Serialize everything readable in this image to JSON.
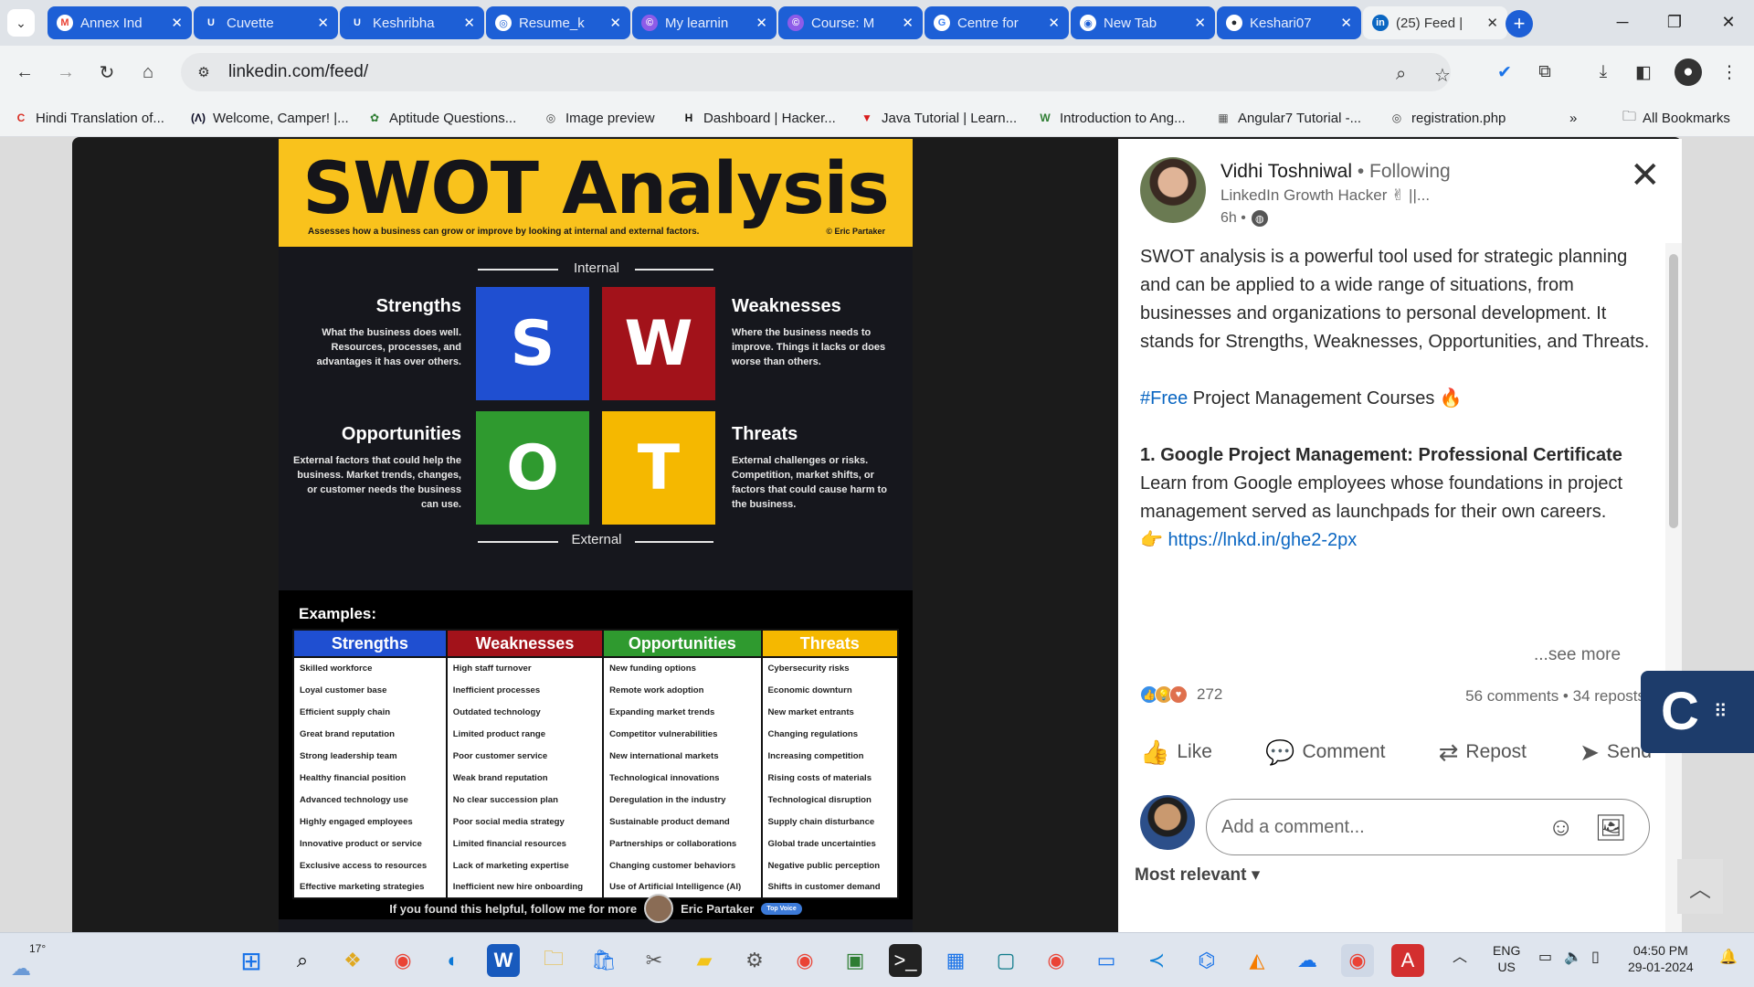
{
  "browser": {
    "tabs": [
      {
        "title": "Annex Ind",
        "icon": "gmail-icon",
        "fav": "M",
        "favColor": "#ea4335",
        "favBg": "#ffffff"
      },
      {
        "title": "Cuvette",
        "icon": "cuvette-icon",
        "fav": "U",
        "favColor": "#ffffff",
        "favBg": "#1d5fd6"
      },
      {
        "title": "Keshribha",
        "icon": "cuvette-icon",
        "fav": "U",
        "favColor": "#ffffff",
        "favBg": "#1d5fd6"
      },
      {
        "title": "Resume_k",
        "icon": "globe-icon",
        "fav": "◎",
        "favColor": "#1d5fd6",
        "favBg": "#ffffff"
      },
      {
        "title": "My learnin",
        "icon": "course-icon",
        "fav": "©",
        "favColor": "#ffffff",
        "favBg": "#8e5ce8"
      },
      {
        "title": "Course: M",
        "icon": "course-icon",
        "fav": "©",
        "favColor": "#ffffff",
        "favBg": "#8e5ce8"
      },
      {
        "title": "Centre for",
        "icon": "google-icon",
        "fav": "G",
        "favColor": "#4285f4",
        "favBg": "#ffffff"
      },
      {
        "title": "New Tab",
        "icon": "chrome-icon",
        "fav": "◉",
        "favColor": "#1d5fd6",
        "favBg": "#ffffff"
      },
      {
        "title": "Keshari07",
        "icon": "github-icon",
        "fav": "●",
        "favColor": "#24292f",
        "favBg": "#ffffff"
      },
      {
        "title": "(25) Feed |",
        "icon": "linkedin-icon",
        "fav": "in",
        "favColor": "#ffffff",
        "favBg": "#0a66c2"
      }
    ],
    "url": "linkedin.com/feed/",
    "bookmarks": [
      {
        "label": "Hindi Translation of...",
        "icon": "C",
        "color": "#d93025"
      },
      {
        "label": "Welcome, Camper! |...",
        "icon": "(Λ)",
        "color": "#0a0a23"
      },
      {
        "label": "Aptitude Questions...",
        "icon": "✿",
        "color": "#2e7d32"
      },
      {
        "label": "Image preview",
        "icon": "◎",
        "color": "#444444"
      },
      {
        "label": "Dashboard | Hacker...",
        "icon": "H",
        "color": "#111111"
      },
      {
        "label": "Java Tutorial | Learn...",
        "icon": "▼",
        "color": "#d81b1b"
      },
      {
        "label": "Introduction to Ang...",
        "icon": "W",
        "color": "#2e7d32"
      },
      {
        "label": "Angular7 Tutorial -...",
        "icon": "▦",
        "color": "#555555"
      },
      {
        "label": "registration.php",
        "icon": "◎",
        "color": "#444444"
      }
    ],
    "all_bookmarks": "All Bookmarks"
  },
  "swot": {
    "title": "SWOT Analysis",
    "subtitle": "Assesses how a business can grow or improve by looking at internal and external factors.",
    "credit": "© Eric Partaker",
    "internal": "Internal",
    "external": "External",
    "quadrants": {
      "s": {
        "letter": "S",
        "title": "Strengths",
        "desc": "What the business does well. Resources, processes, and advantages it has over others.",
        "color": "#1f4fd1"
      },
      "w": {
        "letter": "W",
        "title": "Weaknesses",
        "desc": "Where the business needs to improve. Things it lacks or does worse than others.",
        "color": "#a2121a"
      },
      "o": {
        "letter": "O",
        "title": "Opportunities",
        "desc": "External factors that could help the business. Market trends, changes, or customer needs the business can use.",
        "color": "#2f9a2f"
      },
      "t": {
        "letter": "T",
        "title": "Threats",
        "desc": "External challenges or risks. Competition, market shifts, or factors that could cause harm to the business.",
        "color": "#f5b800"
      }
    },
    "examples_label": "Examples:",
    "columns": [
      {
        "header": "Strengths",
        "color": "#1f4fd1",
        "items": [
          "Skilled workforce",
          "Loyal customer base",
          "Efficient supply chain",
          "Great brand reputation",
          "Strong leadership team",
          "Healthy financial position",
          "Advanced technology use",
          "Highly engaged employees",
          "Innovative product or service",
          "Exclusive access to resources",
          "Effective marketing strategies"
        ]
      },
      {
        "header": "Weaknesses",
        "color": "#a2121a",
        "items": [
          "High staff turnover",
          "Inefficient processes",
          "Outdated technology",
          "Limited product range",
          "Poor customer service",
          "Weak brand reputation",
          "No clear succession plan",
          "Poor social media strategy",
          "Limited financial resources",
          "Lack of marketing expertise",
          "Inefficient new hire onboarding"
        ]
      },
      {
        "header": "Opportunities",
        "color": "#2f9a2f",
        "items": [
          "New funding options",
          "Remote work adoption",
          "Expanding market trends",
          "Competitor vulnerabilities",
          "New international markets",
          "Technological innovations",
          "Deregulation in the industry",
          "Sustainable product demand",
          "Partnerships or collaborations",
          "Changing customer behaviors",
          "Use of Artificial Intelligence (AI)"
        ]
      },
      {
        "header": "Threats",
        "color": "#f5b800",
        "items": [
          "Cybersecurity risks",
          "Economic downturn",
          "New market entrants",
          "Changing regulations",
          "Increasing competition",
          "Rising costs of materials",
          "Technological disruption",
          "Supply chain disturbance",
          "Global trade uncertainties",
          "Negative public perception",
          "Shifts in customer demand"
        ]
      }
    ],
    "footer": "If you found this helpful, follow me for more",
    "footer_name": "Eric Partaker",
    "footer_badge": "Top Voice"
  },
  "post": {
    "author": "Vidhi Toshniwal",
    "following": "• Following",
    "headline": "LinkedIn Growth Hacker ✌ ||...",
    "time": "6h •",
    "intro": "SWOT analysis is a powerful tool used for strategic planning and can be applied to a wide range of situations, from businesses and organizations to personal development. It stands for Strengths, Weaknesses, Opportunities, and Threats.",
    "hashtag": "#Free",
    "hashtag_rest": " Project Management Courses 🔥",
    "course_title": "1. Google Project Management: Professional Certificate",
    "course_desc": "Learn from Google employees whose foundations in project management served as launchpads for their own careers.",
    "pointer": "👉",
    "course_link": "https://lnkd.in/ghe2-2px",
    "see_more": "...see more",
    "reaction_count": "272",
    "comments_reposts": "56 comments • 34 reposts",
    "actions": {
      "like": "Like",
      "comment": "Comment",
      "repost": "Repost",
      "send": "Send"
    },
    "comment_placeholder": "Add a comment...",
    "sort": "Most relevant ▾"
  },
  "taskbar": {
    "temp": "17°",
    "lang": "ENG",
    "region": "US",
    "time": "04:50 PM",
    "date": "29-01-2024"
  }
}
